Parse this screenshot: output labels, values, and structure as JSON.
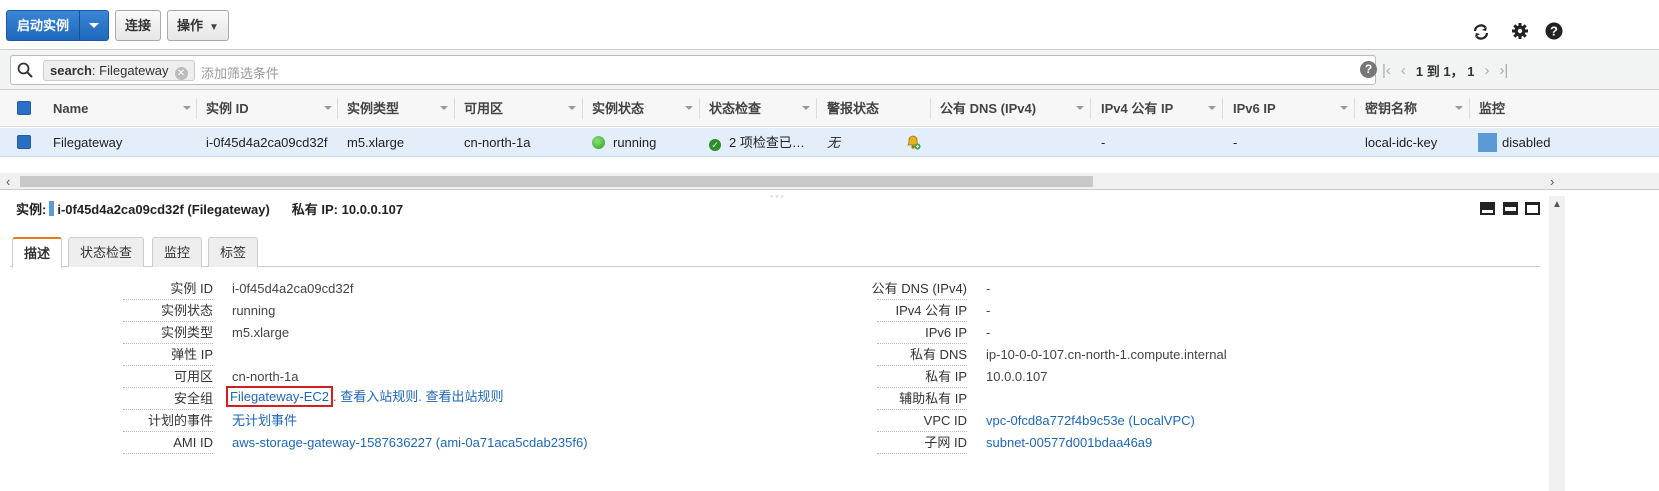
{
  "toolbar": {
    "launch_label": "启动实例",
    "connect_label": "连接",
    "actions_label": "操作"
  },
  "filter": {
    "token_key": "search",
    "token_value": ": Filegateway",
    "placeholder": "添加筛选条件",
    "pagination": "1 到 1， 1"
  },
  "table": {
    "columns": [
      "Name",
      "实例 ID",
      "实例类型",
      "可用区",
      "实例状态",
      "状态检查",
      "警报状态",
      "公有 DNS (IPv4)",
      "IPv4 公有 IP",
      "IPv6 IP",
      "密钥名称",
      "监控"
    ],
    "row": {
      "name": "Filegateway",
      "instance_id": "i-0f45d4a2ca09cd32f",
      "instance_type": "m5.xlarge",
      "az": "cn-north-1a",
      "state": "running",
      "status_check": "2 项检查已…",
      "alarm": "无",
      "public_dns": "",
      "ipv4_public": "-",
      "ipv6": "-",
      "key_name": "local-idc-key",
      "monitoring": "disabled"
    }
  },
  "detail": {
    "instance_prefix": "实例:",
    "instance_title": "i-0f45d4a2ca09cd32f (Filegateway)",
    "private_ip_label": "私有 IP: 10.0.0.107",
    "tabs": [
      "描述",
      "状态检查",
      "监控",
      "标签"
    ],
    "left": [
      {
        "label": "实例 ID",
        "value": "i-0f45d4a2ca09cd32f"
      },
      {
        "label": "实例状态",
        "value": "running"
      },
      {
        "label": "实例类型",
        "value": "m5.xlarge"
      },
      {
        "label": "弹性 IP",
        "value": ""
      },
      {
        "label": "可用区",
        "value": "cn-north-1a"
      },
      {
        "label": "安全组",
        "value": "Filegateway-EC2",
        "link1": "查看入站规则",
        "link2": "查看出站规则"
      },
      {
        "label": "计划的事件",
        "value": "无计划事件"
      },
      {
        "label": "AMI ID",
        "value": "aws-storage-gateway-1587636227 (ami-0a71aca5cdab235f6)"
      }
    ],
    "right": [
      {
        "label": "公有 DNS (IPv4)",
        "value": "-"
      },
      {
        "label": "IPv4 公有 IP",
        "value": "-"
      },
      {
        "label": "IPv6 IP",
        "value": "-"
      },
      {
        "label": "私有 DNS",
        "value": "ip-10-0-0-107.cn-north-1.compute.internal"
      },
      {
        "label": "私有 IP",
        "value": "10.0.0.107"
      },
      {
        "label": "辅助私有 IP",
        "value": ""
      },
      {
        "label": "VPC ID",
        "value": "vpc-0fcd8a772f4b9c53e (LocalVPC)"
      },
      {
        "label": "子网 ID",
        "value": "subnet-00577d001bdaa46a9"
      }
    ]
  },
  "colors": {
    "accent": "#1f69bd",
    "selected_row": "#e3eefa",
    "link": "#1f66b5",
    "tab_active": "#e07b1a",
    "highlight_box": "#d21f1f"
  }
}
